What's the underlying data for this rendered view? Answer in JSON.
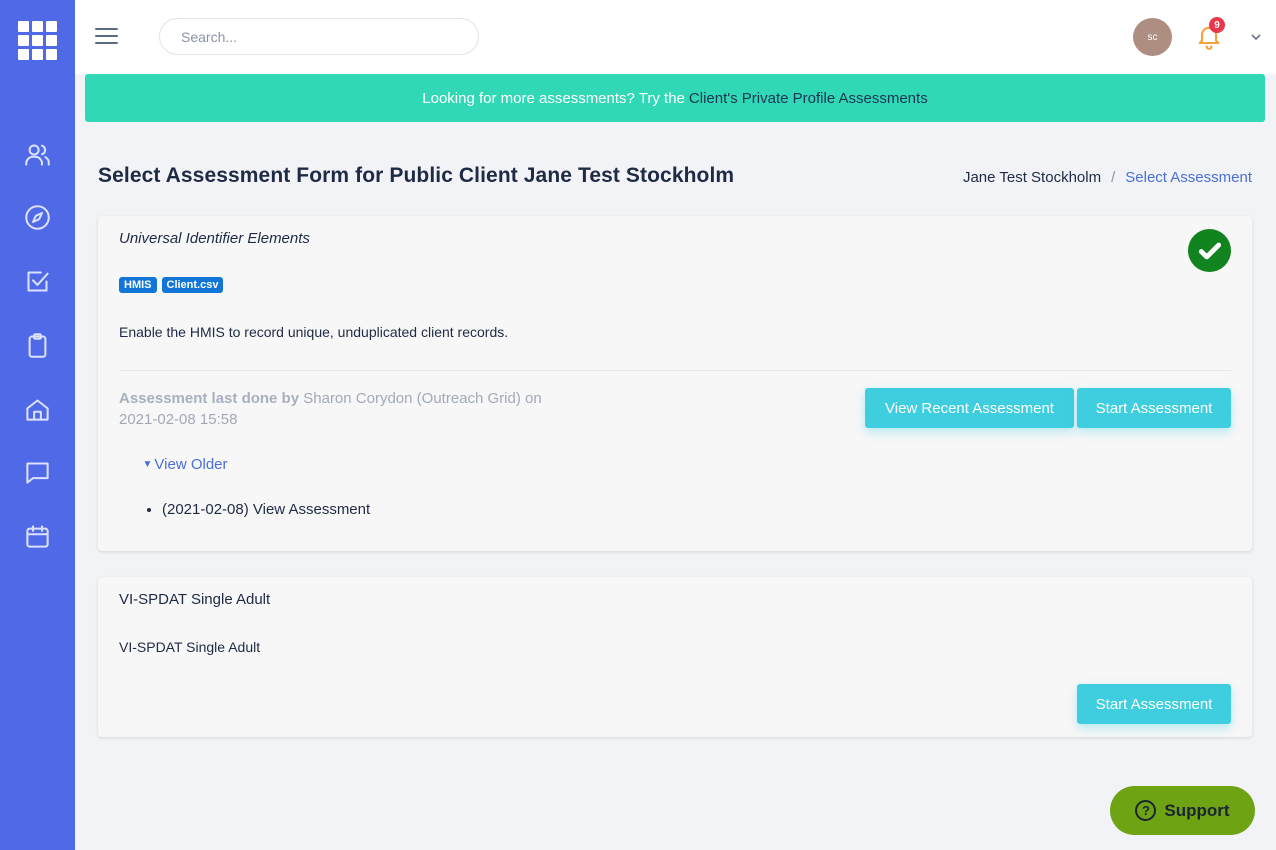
{
  "app": {
    "logo_icon": "apps-grid-icon",
    "accent": "#5069e6"
  },
  "sidebar": {
    "items": [
      {
        "icon": "users-icon"
      },
      {
        "icon": "compass-icon"
      },
      {
        "icon": "checkbox-icon"
      },
      {
        "icon": "clipboard-icon"
      },
      {
        "icon": "home-icon"
      },
      {
        "icon": "chat-icon"
      },
      {
        "icon": "calendar-icon"
      }
    ]
  },
  "header": {
    "search_placeholder": "Search...",
    "avatar_initials": "sc",
    "notification_count": "9"
  },
  "banner": {
    "text": "Looking for more assessments? Try the",
    "link": "Client's Private Profile Assessments",
    "color": "#31d8b5"
  },
  "page": {
    "title": "Select Assessment Form for Public Client Jane Test Stockholm",
    "breadcrumb": {
      "home": "Jane Test Stockholm",
      "separator": "/",
      "current": "Select Assessment"
    }
  },
  "cards": [
    {
      "title": "Universal Identifier Elements",
      "status_icon": "check-circle-icon",
      "tags": [
        "HMIS",
        "Client.csv"
      ],
      "description": "Enable the HMIS to record unique, unduplicated client records.",
      "last_done_label": "Assessment last done by",
      "last_done_by": "Sharon Corydon (Outreach Grid) on",
      "last_done_date": "2021-02-08 15:58",
      "view_recent_label": "View Recent Assessment",
      "start_label": "Start Assessment",
      "view_older_label": "View Older",
      "older": [
        "(2021-02-08) View Assessment"
      ]
    },
    {
      "title": "VI-SPDAT Single Adult",
      "description": "VI-SPDAT Single Adult",
      "start_label": "Start Assessment"
    }
  ],
  "support": {
    "label": "Support",
    "color": "#6ea414"
  }
}
